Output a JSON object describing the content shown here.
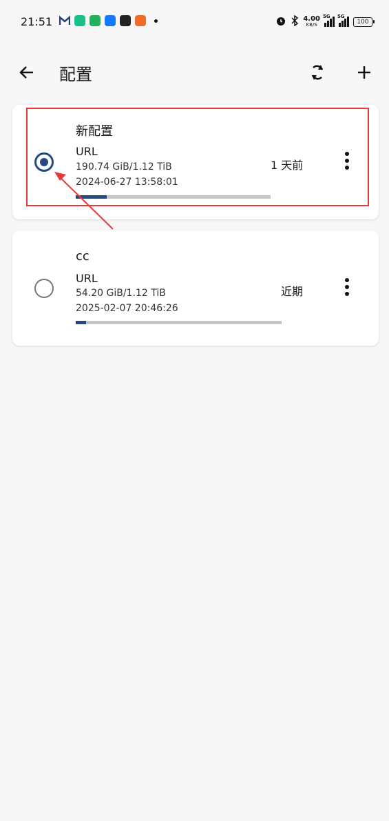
{
  "status_bar": {
    "time": "21:51",
    "net_speed": "4.00",
    "net_speed_unit": "KB/S",
    "network_1": "5G",
    "network_2": "5G",
    "battery": "100",
    "app_icons": [
      "mail-m-icon",
      "app-green-icon",
      "app-shield-icon",
      "alipay-icon",
      "mail-icon",
      "app-orange-icon"
    ]
  },
  "app_bar": {
    "title": "配置"
  },
  "profiles": [
    {
      "name": "新配置",
      "type": "URL",
      "usage": "190.74 GiB/1.12 TiB",
      "date": "2024-06-27 13:58:01",
      "updated": "1 天前",
      "selected": true,
      "usage_fraction": 0.16
    },
    {
      "name": "cc",
      "type": "URL",
      "usage": "54.20 GiB/1.12 TiB",
      "date": "2025-02-07 20:46:26",
      "updated": "近期",
      "selected": false,
      "usage_fraction": 0.05
    }
  ],
  "colors": {
    "accent": "#234a80",
    "highlight": "#e83a3a",
    "background": "#f7f7f7"
  }
}
